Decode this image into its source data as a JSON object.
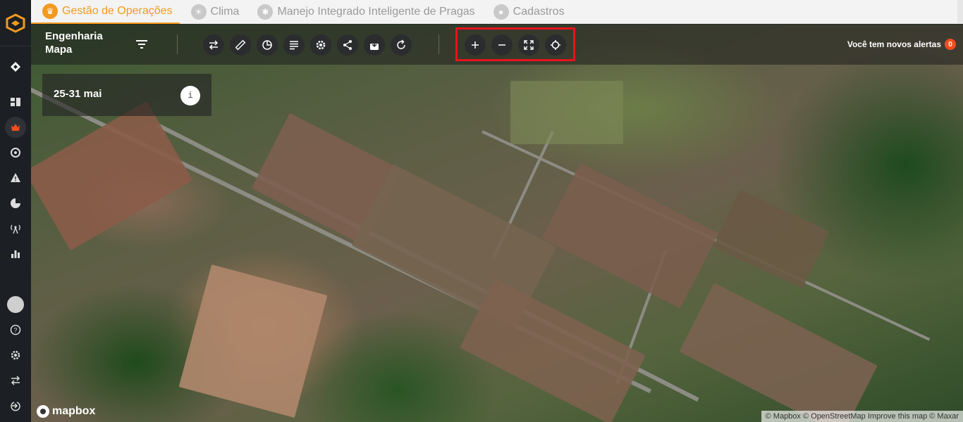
{
  "sidebar": {
    "items": [
      {
        "icon": "dashboard-icon"
      },
      {
        "icon": "operations-icon",
        "active": true
      },
      {
        "icon": "pest-icon"
      },
      {
        "icon": "alert-icon"
      },
      {
        "icon": "pie-chart-icon"
      },
      {
        "icon": "antenna-icon"
      },
      {
        "icon": "bar-chart-icon"
      }
    ],
    "bottom": [
      "avatar",
      "help-icon",
      "gear-icon",
      "swap-icon",
      "logout-icon"
    ]
  },
  "topnav": {
    "tabs": [
      {
        "label": "Gestão de Operações",
        "active": true
      },
      {
        "label": "Clima"
      },
      {
        "label": "Manejo Integrado Inteligente de Pragas"
      },
      {
        "label": "Cadastros"
      }
    ]
  },
  "toolbar": {
    "title_line1": "Engenharia",
    "title_line2": "Mapa",
    "alerts_label": "Você tem novos alertas",
    "alerts_count": "0"
  },
  "date_card": {
    "label": "25-31 mai",
    "info": "i"
  },
  "map": {
    "brand": "mapbox",
    "attribution": "© Mapbox © OpenStreetMap Improve this map © Maxar"
  },
  "colors": {
    "accent": "#f29a20",
    "highlight": "#e8131b",
    "badge": "#f24d1d"
  }
}
